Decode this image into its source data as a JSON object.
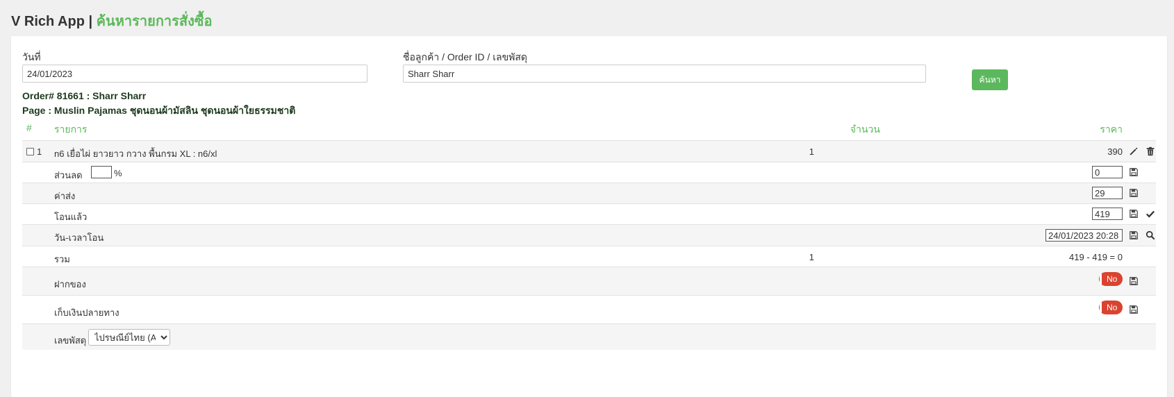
{
  "header": {
    "app_name": "V Rich App |",
    "page_title": "ค้นหารายการสั่งซื้อ"
  },
  "search": {
    "date_label": "วันที่",
    "date_value": "24/01/2023",
    "customer_label": "ชื่อลูกค้า / Order ID / เลขพัสดุ",
    "customer_value": "Sharr Sharr",
    "button_label": "ค้นหา"
  },
  "order": {
    "title": "Order# 81661 : Sharr Sharr",
    "page": "Page : Muslin Pajamas ชุดนอนผ้ามัสลิน ชุดนอนผ้าใยธรรมชาติ"
  },
  "table": {
    "headers": {
      "index": "#",
      "item": "รายการ",
      "qty": "จำนวน",
      "price": "ราคา"
    },
    "items": [
      {
        "index": "1",
        "name": "n6 เยื่อไผ่ ยาวยาว กวาง พื้นกรม XL : n6/xl",
        "qty": "1",
        "price": "390"
      }
    ],
    "discount": {
      "label": "ส่วนลด",
      "percent_value": "",
      "percent_sign": "%",
      "amount_value": "0"
    },
    "shipping": {
      "label": "ค่าส่ง",
      "value": "29"
    },
    "paid": {
      "label": "โอนแล้ว",
      "value": "419"
    },
    "transfer_time": {
      "label": "วัน-เวลาโอน",
      "value": "24/01/2023 20:28"
    },
    "total": {
      "label": "รวม",
      "qty": "1",
      "summary": "419 - 419 = 0"
    },
    "deposit": {
      "label": "ฝากของ",
      "toggle_label": "No"
    },
    "cod": {
      "label": "เก็บเงินปลายทาง",
      "toggle_label": "No"
    },
    "tracking": {
      "label": "เลขพัสดุ",
      "selected_carrier": "ไปรษณีย์ไทย (API)"
    }
  },
  "colors": {
    "accent_green": "#5cb85c",
    "toggle_red": "#d9432f"
  },
  "icons": {
    "edit": "pencil-icon",
    "delete": "trash-icon",
    "save": "save-icon",
    "confirm": "check-icon",
    "search": "magnifier-icon"
  }
}
